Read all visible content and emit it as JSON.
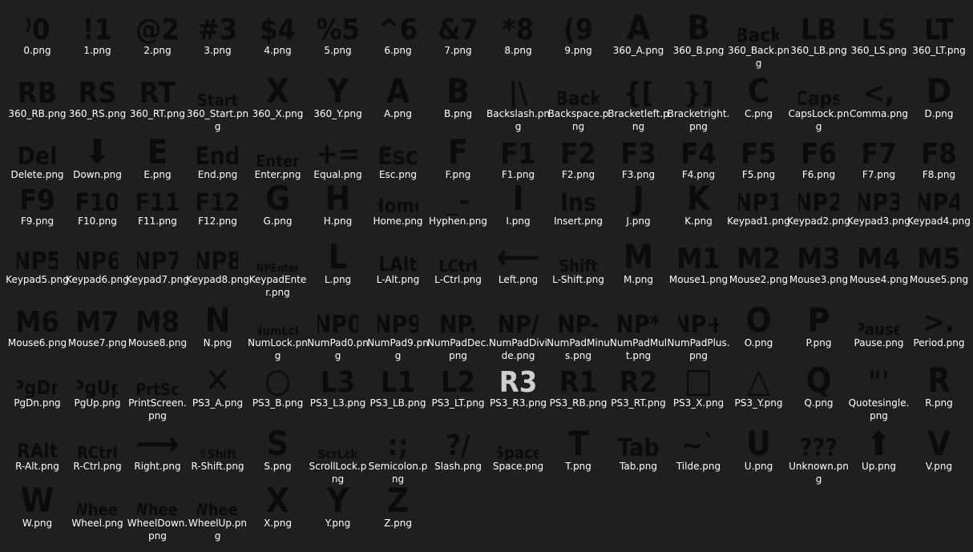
{
  "colors": {
    "background": "#1f1f1f",
    "label": "#ffffff",
    "glyph": "#0b0b0b",
    "glyph_selected": "#cfcfcf"
  },
  "selected_item": "PS3_R3.png",
  "items": [
    {
      "glyph": "⁾0",
      "label": "0.png"
    },
    {
      "glyph": "!1",
      "label": "1.png"
    },
    {
      "glyph": "@2",
      "label": "2.png"
    },
    {
      "glyph": "#3",
      "label": "3.png"
    },
    {
      "glyph": "$4",
      "label": "4.png"
    },
    {
      "glyph": "%5",
      "label": "5.png"
    },
    {
      "glyph": "^6",
      "label": "6.png"
    },
    {
      "glyph": "&7",
      "label": "7.png"
    },
    {
      "glyph": "*8",
      "label": "8.png"
    },
    {
      "glyph": "(9",
      "label": "9.png"
    },
    {
      "glyph": "A",
      "label": "360_A.png"
    },
    {
      "glyph": "B",
      "label": "360_B.png"
    },
    {
      "glyph": "Back",
      "label": "360_Back.png"
    },
    {
      "glyph": "LB",
      "label": "360_LB.png"
    },
    {
      "glyph": "LS",
      "label": "360_LS.png"
    },
    {
      "glyph": "LT",
      "label": "360_LT.png"
    },
    {
      "glyph": "RB",
      "label": "360_RB.png"
    },
    {
      "glyph": "RS",
      "label": "360_RS.png"
    },
    {
      "glyph": "RT",
      "label": "360_RT.png"
    },
    {
      "glyph": "Start",
      "label": "360_Start.png"
    },
    {
      "glyph": "X",
      "label": "360_X.png"
    },
    {
      "glyph": "Y",
      "label": "360_Y.png"
    },
    {
      "glyph": "A",
      "label": "A.png"
    },
    {
      "glyph": "B",
      "label": "B.png"
    },
    {
      "glyph": "|\\",
      "label": "Backslash.png"
    },
    {
      "glyph": "Back",
      "label": "Backspace.png"
    },
    {
      "glyph": "{[",
      "label": "Bracketleft.png"
    },
    {
      "glyph": "}]",
      "label": "Bracketright.png"
    },
    {
      "glyph": "C",
      "label": "C.png"
    },
    {
      "glyph": "Caps",
      "label": "CapsLock.png"
    },
    {
      "glyph": "<,",
      "label": "Comma.png"
    },
    {
      "glyph": "D",
      "label": "D.png"
    },
    {
      "glyph": "Del",
      "label": "Delete.png"
    },
    {
      "glyph": "⬇",
      "label": "Down.png"
    },
    {
      "glyph": "E",
      "label": "E.png"
    },
    {
      "glyph": "End",
      "label": "End.png"
    },
    {
      "glyph": "Enter",
      "label": "Enter.png"
    },
    {
      "glyph": "+=",
      "label": "Equal.png"
    },
    {
      "glyph": "Esc",
      "label": "Esc.png"
    },
    {
      "glyph": "F",
      "label": "F.png"
    },
    {
      "glyph": "F1",
      "label": "F1.png"
    },
    {
      "glyph": "F2",
      "label": "F2.png"
    },
    {
      "glyph": "F3",
      "label": "F3.png"
    },
    {
      "glyph": "F4",
      "label": "F4.png"
    },
    {
      "glyph": "F5",
      "label": "F5.png"
    },
    {
      "glyph": "F6",
      "label": "F6.png"
    },
    {
      "glyph": "F7",
      "label": "F7.png"
    },
    {
      "glyph": "F8",
      "label": "F8.png"
    },
    {
      "glyph": "F9",
      "label": "F9.png"
    },
    {
      "glyph": "F10",
      "label": "F10.png"
    },
    {
      "glyph": "F11",
      "label": "F11.png"
    },
    {
      "glyph": "F12",
      "label": "F12.png"
    },
    {
      "glyph": "G",
      "label": "G.png"
    },
    {
      "glyph": "H",
      "label": "H.png"
    },
    {
      "glyph": "Home",
      "label": "Home.png"
    },
    {
      "glyph": "_-",
      "label": "Hyphen.png"
    },
    {
      "glyph": "I",
      "label": "I.png"
    },
    {
      "glyph": "Ins",
      "label": "Insert.png"
    },
    {
      "glyph": "J",
      "label": "J.png"
    },
    {
      "glyph": "K",
      "label": "K.png"
    },
    {
      "glyph": "NP1",
      "label": "Keypad1.png"
    },
    {
      "glyph": "NP2",
      "label": "Keypad2.png"
    },
    {
      "glyph": "NP3",
      "label": "Keypad3.png"
    },
    {
      "glyph": "NP4",
      "label": "Keypad4.png"
    },
    {
      "glyph": "NP5",
      "label": "Keypad5.png"
    },
    {
      "glyph": "NP6",
      "label": "Keypad6.png"
    },
    {
      "glyph": "NP7",
      "label": "Keypad7.png"
    },
    {
      "glyph": "NP8",
      "label": "Keypad8.png"
    },
    {
      "glyph": "NPEnter",
      "label": "KeypadEnter.png"
    },
    {
      "glyph": "L",
      "label": "L.png"
    },
    {
      "glyph": "LAlt",
      "label": "L-Alt.png"
    },
    {
      "glyph": "LCtrl",
      "label": "L-Ctrl.png"
    },
    {
      "glyph": "⟵",
      "label": "Left.png"
    },
    {
      "glyph": "Shift",
      "label": "L-Shift.png"
    },
    {
      "glyph": "M",
      "label": "M.png"
    },
    {
      "glyph": "M1",
      "label": "Mouse1.png"
    },
    {
      "glyph": "M2",
      "label": "Mouse2.png"
    },
    {
      "glyph": "M3",
      "label": "Mouse3.png"
    },
    {
      "glyph": "M4",
      "label": "Mouse4.png"
    },
    {
      "glyph": "M5",
      "label": "Mouse5.png"
    },
    {
      "glyph": "M6",
      "label": "Mouse6.png"
    },
    {
      "glyph": "M7",
      "label": "Mouse7.png"
    },
    {
      "glyph": "M8",
      "label": "Mouse8.png"
    },
    {
      "glyph": "N",
      "label": "N.png"
    },
    {
      "glyph": "NumLck",
      "label": "NumLock.png"
    },
    {
      "glyph": "NP0",
      "label": "NumPad0.png"
    },
    {
      "glyph": "NP9",
      "label": "NumPad9.png"
    },
    {
      "glyph": "NP.",
      "label": "NumPadDec.png"
    },
    {
      "glyph": "NP/",
      "label": "NumPadDivide.png"
    },
    {
      "glyph": "NP-",
      "label": "NumPadMinus.png"
    },
    {
      "glyph": "NP*",
      "label": "NumPadMult.png"
    },
    {
      "glyph": "NP+",
      "label": "NumPadPlus.png"
    },
    {
      "glyph": "O",
      "label": "O.png"
    },
    {
      "glyph": "P",
      "label": "P.png"
    },
    {
      "glyph": "Pause",
      "label": "Pause.png"
    },
    {
      "glyph": ">.",
      "label": "Period.png"
    },
    {
      "glyph": "PgDn",
      "label": "PgDn.png"
    },
    {
      "glyph": "PgUp",
      "label": "PgUp.png"
    },
    {
      "glyph": "PrtSc",
      "label": "PrintScreen.png"
    },
    {
      "glyph": "✕",
      "label": "PS3_A.png"
    },
    {
      "glyph": "○",
      "label": "PS3_B.png"
    },
    {
      "glyph": "L3",
      "label": "PS3_L3.png"
    },
    {
      "glyph": "L1",
      "label": "PS3_LB.png"
    },
    {
      "glyph": "L2",
      "label": "PS3_LT.png"
    },
    {
      "glyph": "R3",
      "label": "PS3_R3.png"
    },
    {
      "glyph": "R1",
      "label": "PS3_RB.png"
    },
    {
      "glyph": "R2",
      "label": "PS3_RT.png"
    },
    {
      "glyph": "□",
      "label": "PS3_X.png"
    },
    {
      "glyph": "△",
      "label": "PS3_Y.png"
    },
    {
      "glyph": "Q",
      "label": "Q.png"
    },
    {
      "glyph": "\"'",
      "label": "Quotesingle.png"
    },
    {
      "glyph": "R",
      "label": "R.png"
    },
    {
      "glyph": "RAlt",
      "label": "R-Alt.png"
    },
    {
      "glyph": "RCtrl",
      "label": "R-Ctrl.png"
    },
    {
      "glyph": "⟶",
      "label": "Right.png"
    },
    {
      "glyph": "⇧Shift",
      "label": "R-Shift.png"
    },
    {
      "glyph": "S",
      "label": "S.png"
    },
    {
      "glyph": "ScrLck",
      "label": "ScrollLock.png"
    },
    {
      "glyph": ":;",
      "label": "Semicolon.png"
    },
    {
      "glyph": "?/",
      "label": "Slash.png"
    },
    {
      "glyph": "Space",
      "label": "Space.png"
    },
    {
      "glyph": "T",
      "label": "T.png"
    },
    {
      "glyph": "Tab",
      "label": "Tab.png"
    },
    {
      "glyph": "~`",
      "label": "Tilde.png"
    },
    {
      "glyph": "U",
      "label": "U.png"
    },
    {
      "glyph": "???",
      "label": "Unknown.png"
    },
    {
      "glyph": "⬆",
      "label": "Up.png"
    },
    {
      "glyph": "V",
      "label": "V.png"
    },
    {
      "glyph": "W",
      "label": "W.png"
    },
    {
      "glyph": "Wheel",
      "label": "Wheel.png"
    },
    {
      "glyph": "Wheel",
      "label": "WheelDown.png"
    },
    {
      "glyph": "Wheel",
      "label": "WheelUp.png"
    },
    {
      "glyph": "X",
      "label": "X.png"
    },
    {
      "glyph": "Y",
      "label": "Y.png"
    },
    {
      "glyph": "Z",
      "label": "Z.png"
    }
  ]
}
